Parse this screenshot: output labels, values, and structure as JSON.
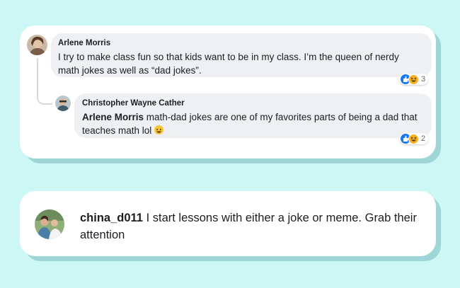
{
  "comment1": {
    "author": "Arlene Morris",
    "text": "I try to make class fun so that kids want to be in my class. I’m the queen of nerdy math jokes as well as “dad jokes”.",
    "reaction_count": "3"
  },
  "reply1": {
    "author": "Christopher Wayne Cather",
    "mention": "Arlene Morris",
    "text": " math-dad jokes are one of my favorites parts of being a dad that teaches math lol",
    "reaction_count": "2"
  },
  "post2": {
    "username": "china_d011",
    "text": " I start lessons with either a joke or meme. Grab their attention"
  },
  "colors": {
    "background": "#ccf7f5",
    "card": "#ffffff",
    "bubble": "#eef0f3",
    "like": "#1877f2",
    "haha": "#f7b125"
  },
  "icons": [
    "like-icon",
    "haha-icon",
    "grin-emoji-icon"
  ]
}
